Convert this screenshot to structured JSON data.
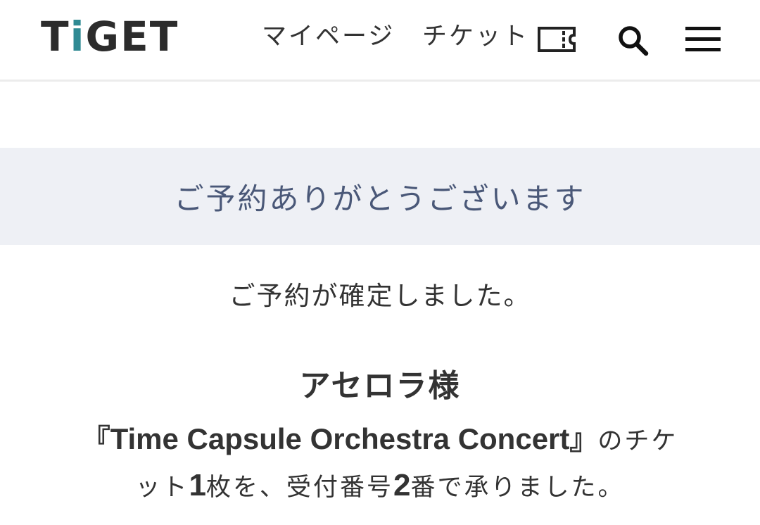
{
  "header": {
    "logo": {
      "letters": [
        "T",
        "i",
        "G",
        "E",
        "T"
      ],
      "alt": "TiGET"
    },
    "nav": {
      "mypage_label": "マイページ",
      "ticket_label": "チケット"
    },
    "icons": {
      "ticket": "ticket-icon",
      "search": "search-icon",
      "menu": "hamburger-menu-icon"
    }
  },
  "banner": {
    "thanks": "ご予約ありがとうございます"
  },
  "main": {
    "confirmed": "ご予約が確定しました。",
    "customer_name": "アセロラ様",
    "message": {
      "open_bracket": "『",
      "event_title": "Time Capsule Orchestra Concert",
      "close_bracket": "』",
      "part1": "のチケ",
      "part2": "ット",
      "ticket_count": "1",
      "part3": "枚を、受付番号",
      "reception_number": "2",
      "part4": "番で承りました。"
    }
  },
  "colors": {
    "logo_accent": "#2f8a93",
    "banner_bg": "#eef0f5",
    "banner_text": "#4a5878",
    "text": "#333333"
  }
}
